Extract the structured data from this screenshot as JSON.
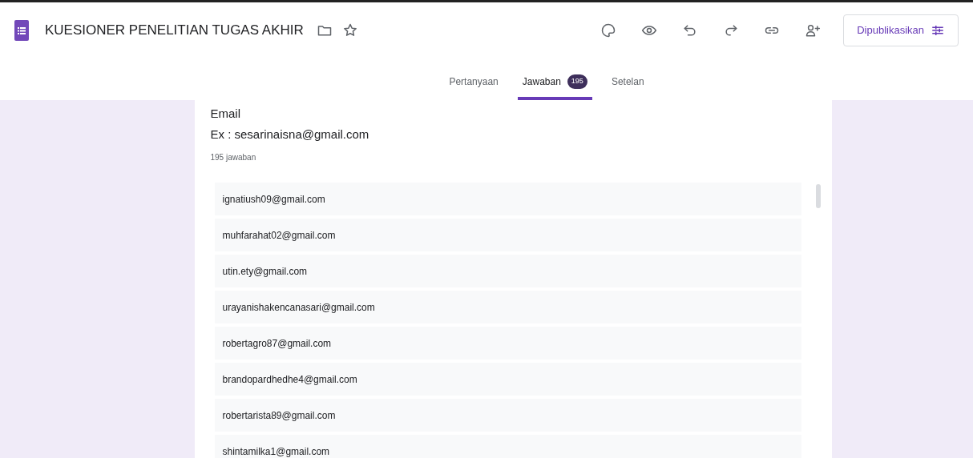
{
  "header": {
    "title": "KUESIONER PENELITIAN TUGAS AKHIR",
    "publish_button": "Dipublikasikan"
  },
  "tabs": [
    {
      "label": "Pertanyaan",
      "selected": false
    },
    {
      "label": "Jawaban",
      "selected": true,
      "badge": "195"
    },
    {
      "label": "Setelan",
      "selected": false
    }
  ],
  "question": {
    "title": "Email",
    "description": "Ex : sesarinaisna@gmail.com",
    "count": "195 jawaban"
  },
  "responses": [
    "ignatiush09@gmail.com",
    "muhfarahat02@gmail.com",
    "utin.ety@gmail.com",
    "urayanishakencanasari@gmail.com",
    "robertagro87@gmail.com",
    "brandopardhedhe4@gmail.com",
    "robertarista89@gmail.com",
    "shintamilka1@gmail.com"
  ]
}
